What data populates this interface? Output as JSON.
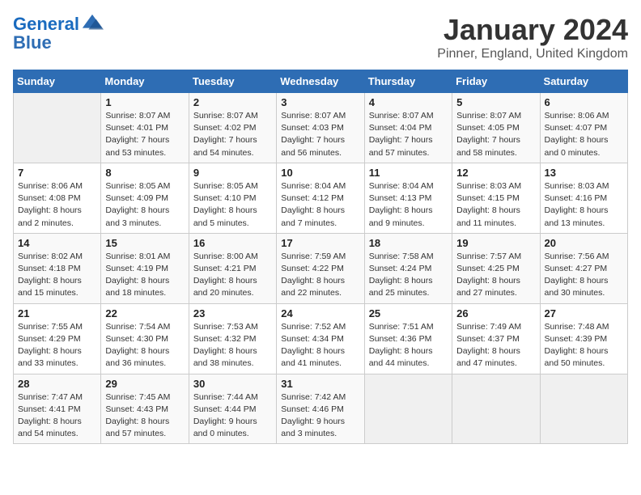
{
  "logo": {
    "line1": "General",
    "line2": "Blue"
  },
  "title": "January 2024",
  "subtitle": "Pinner, England, United Kingdom",
  "weekdays": [
    "Sunday",
    "Monday",
    "Tuesday",
    "Wednesday",
    "Thursday",
    "Friday",
    "Saturday"
  ],
  "weeks": [
    [
      {
        "day": "",
        "sunrise": "",
        "sunset": "",
        "daylight": ""
      },
      {
        "day": "1",
        "sunrise": "Sunrise: 8:07 AM",
        "sunset": "Sunset: 4:01 PM",
        "daylight": "Daylight: 7 hours and 53 minutes."
      },
      {
        "day": "2",
        "sunrise": "Sunrise: 8:07 AM",
        "sunset": "Sunset: 4:02 PM",
        "daylight": "Daylight: 7 hours and 54 minutes."
      },
      {
        "day": "3",
        "sunrise": "Sunrise: 8:07 AM",
        "sunset": "Sunset: 4:03 PM",
        "daylight": "Daylight: 7 hours and 56 minutes."
      },
      {
        "day": "4",
        "sunrise": "Sunrise: 8:07 AM",
        "sunset": "Sunset: 4:04 PM",
        "daylight": "Daylight: 7 hours and 57 minutes."
      },
      {
        "day": "5",
        "sunrise": "Sunrise: 8:07 AM",
        "sunset": "Sunset: 4:05 PM",
        "daylight": "Daylight: 7 hours and 58 minutes."
      },
      {
        "day": "6",
        "sunrise": "Sunrise: 8:06 AM",
        "sunset": "Sunset: 4:07 PM",
        "daylight": "Daylight: 8 hours and 0 minutes."
      }
    ],
    [
      {
        "day": "7",
        "sunrise": "Sunrise: 8:06 AM",
        "sunset": "Sunset: 4:08 PM",
        "daylight": "Daylight: 8 hours and 2 minutes."
      },
      {
        "day": "8",
        "sunrise": "Sunrise: 8:05 AM",
        "sunset": "Sunset: 4:09 PM",
        "daylight": "Daylight: 8 hours and 3 minutes."
      },
      {
        "day": "9",
        "sunrise": "Sunrise: 8:05 AM",
        "sunset": "Sunset: 4:10 PM",
        "daylight": "Daylight: 8 hours and 5 minutes."
      },
      {
        "day": "10",
        "sunrise": "Sunrise: 8:04 AM",
        "sunset": "Sunset: 4:12 PM",
        "daylight": "Daylight: 8 hours and 7 minutes."
      },
      {
        "day": "11",
        "sunrise": "Sunrise: 8:04 AM",
        "sunset": "Sunset: 4:13 PM",
        "daylight": "Daylight: 8 hours and 9 minutes."
      },
      {
        "day": "12",
        "sunrise": "Sunrise: 8:03 AM",
        "sunset": "Sunset: 4:15 PM",
        "daylight": "Daylight: 8 hours and 11 minutes."
      },
      {
        "day": "13",
        "sunrise": "Sunrise: 8:03 AM",
        "sunset": "Sunset: 4:16 PM",
        "daylight": "Daylight: 8 hours and 13 minutes."
      }
    ],
    [
      {
        "day": "14",
        "sunrise": "Sunrise: 8:02 AM",
        "sunset": "Sunset: 4:18 PM",
        "daylight": "Daylight: 8 hours and 15 minutes."
      },
      {
        "day": "15",
        "sunrise": "Sunrise: 8:01 AM",
        "sunset": "Sunset: 4:19 PM",
        "daylight": "Daylight: 8 hours and 18 minutes."
      },
      {
        "day": "16",
        "sunrise": "Sunrise: 8:00 AM",
        "sunset": "Sunset: 4:21 PM",
        "daylight": "Daylight: 8 hours and 20 minutes."
      },
      {
        "day": "17",
        "sunrise": "Sunrise: 7:59 AM",
        "sunset": "Sunset: 4:22 PM",
        "daylight": "Daylight: 8 hours and 22 minutes."
      },
      {
        "day": "18",
        "sunrise": "Sunrise: 7:58 AM",
        "sunset": "Sunset: 4:24 PM",
        "daylight": "Daylight: 8 hours and 25 minutes."
      },
      {
        "day": "19",
        "sunrise": "Sunrise: 7:57 AM",
        "sunset": "Sunset: 4:25 PM",
        "daylight": "Daylight: 8 hours and 27 minutes."
      },
      {
        "day": "20",
        "sunrise": "Sunrise: 7:56 AM",
        "sunset": "Sunset: 4:27 PM",
        "daylight": "Daylight: 8 hours and 30 minutes."
      }
    ],
    [
      {
        "day": "21",
        "sunrise": "Sunrise: 7:55 AM",
        "sunset": "Sunset: 4:29 PM",
        "daylight": "Daylight: 8 hours and 33 minutes."
      },
      {
        "day": "22",
        "sunrise": "Sunrise: 7:54 AM",
        "sunset": "Sunset: 4:30 PM",
        "daylight": "Daylight: 8 hours and 36 minutes."
      },
      {
        "day": "23",
        "sunrise": "Sunrise: 7:53 AM",
        "sunset": "Sunset: 4:32 PM",
        "daylight": "Daylight: 8 hours and 38 minutes."
      },
      {
        "day": "24",
        "sunrise": "Sunrise: 7:52 AM",
        "sunset": "Sunset: 4:34 PM",
        "daylight": "Daylight: 8 hours and 41 minutes."
      },
      {
        "day": "25",
        "sunrise": "Sunrise: 7:51 AM",
        "sunset": "Sunset: 4:36 PM",
        "daylight": "Daylight: 8 hours and 44 minutes."
      },
      {
        "day": "26",
        "sunrise": "Sunrise: 7:49 AM",
        "sunset": "Sunset: 4:37 PM",
        "daylight": "Daylight: 8 hours and 47 minutes."
      },
      {
        "day": "27",
        "sunrise": "Sunrise: 7:48 AM",
        "sunset": "Sunset: 4:39 PM",
        "daylight": "Daylight: 8 hours and 50 minutes."
      }
    ],
    [
      {
        "day": "28",
        "sunrise": "Sunrise: 7:47 AM",
        "sunset": "Sunset: 4:41 PM",
        "daylight": "Daylight: 8 hours and 54 minutes."
      },
      {
        "day": "29",
        "sunrise": "Sunrise: 7:45 AM",
        "sunset": "Sunset: 4:43 PM",
        "daylight": "Daylight: 8 hours and 57 minutes."
      },
      {
        "day": "30",
        "sunrise": "Sunrise: 7:44 AM",
        "sunset": "Sunset: 4:44 PM",
        "daylight": "Daylight: 9 hours and 0 minutes."
      },
      {
        "day": "31",
        "sunrise": "Sunrise: 7:42 AM",
        "sunset": "Sunset: 4:46 PM",
        "daylight": "Daylight: 9 hours and 3 minutes."
      },
      {
        "day": "",
        "sunrise": "",
        "sunset": "",
        "daylight": ""
      },
      {
        "day": "",
        "sunrise": "",
        "sunset": "",
        "daylight": ""
      },
      {
        "day": "",
        "sunrise": "",
        "sunset": "",
        "daylight": ""
      }
    ]
  ]
}
